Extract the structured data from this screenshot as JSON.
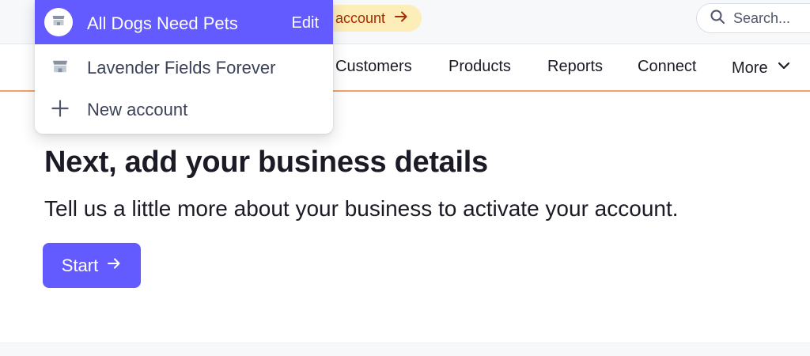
{
  "topbar": {
    "activate_label": "account",
    "search_placeholder": "Search..."
  },
  "nav": {
    "items": [
      {
        "label": "Customers"
      },
      {
        "label": "Products"
      },
      {
        "label": "Reports"
      },
      {
        "label": "Connect"
      },
      {
        "label": "More"
      }
    ]
  },
  "main": {
    "title": "Next, add your business details",
    "subtitle": "Tell us a little more about your business to activate your account.",
    "start_label": "Start"
  },
  "account_menu": {
    "active_account": "All Dogs Need Pets",
    "edit_label": "Edit",
    "other_account": "Lavender Fields Forever",
    "new_account_label": "New account"
  },
  "colors": {
    "accent": "#635bff",
    "activate_bg": "#fcedb9",
    "activate_text": "#a82c00",
    "nav_underline": "#f0a167"
  },
  "icons": {
    "store": "store-icon",
    "plus": "plus-icon",
    "search": "search-icon",
    "arrow": "arrow-right-icon",
    "chevron": "chevron-down-icon"
  }
}
